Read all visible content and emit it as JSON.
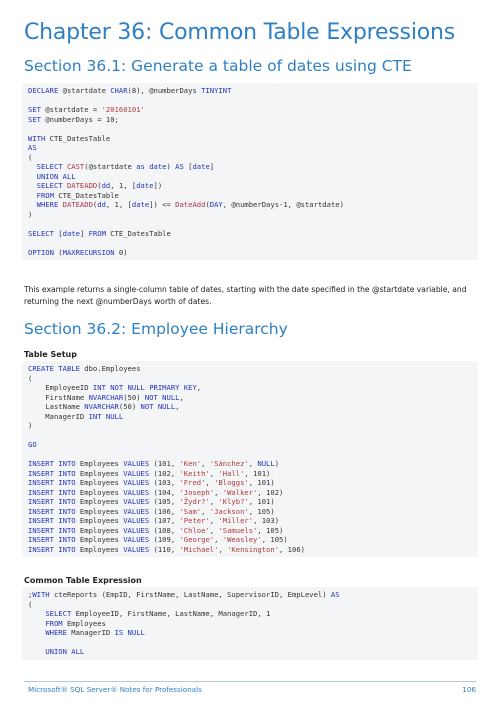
{
  "chapter_title": "Chapter 36: Common Table Expressions",
  "section1": {
    "title": "Section 36.1: Generate a table of dates using CTE",
    "code_lines": [
      "DECLARE @startdate CHAR(8), @numberDays TINYINT",
      "",
      "SET @startdate = '20160101'",
      "SET @numberDays = 10;",
      "",
      "WITH CTE_DatesTable",
      "AS",
      "(",
      "  SELECT CAST(@startdate as date) AS [date]",
      "  UNION ALL",
      "  SELECT DATEADD(dd, 1, [date])",
      "  FROM CTE_DatesTable",
      "  WHERE DATEADD(dd, 1, [date]) <= DateAdd(DAY, @numberDays-1, @startdate)",
      ")",
      "",
      "SELECT [date] FROM CTE_DatesTable",
      "",
      "OPTION (MAXRECURSION 0)"
    ],
    "paragraph": "This example returns a single-column table of dates, starting with the date specified in the @startdate variable, and returning the next @numberDays worth of dates."
  },
  "section2": {
    "title": "Section 36.2: Employee Hierarchy",
    "table_setup_label": "Table Setup",
    "table_setup_lines": [
      "CREATE TABLE dbo.Employees",
      "(",
      "    EmployeeID INT NOT NULL PRIMARY KEY,",
      "    FirstName NVARCHAR(50) NOT NULL,",
      "    LastName NVARCHAR(50) NOT NULL,",
      "    ManagerID INT NULL",
      ")",
      "",
      "GO",
      "",
      "INSERT INTO Employees VALUES (101, 'Ken', 'Sánchez', NULL)",
      "INSERT INTO Employees VALUES (102, 'Keith', 'Hall', 101)",
      "INSERT INTO Employees VALUES (103, 'Fred', 'Bloggs', 101)",
      "INSERT INTO Employees VALUES (104, 'Joseph', 'Walker', 102)",
      "INSERT INTO Employees VALUES (105, 'Žydr?', 'Klyb?', 101)",
      "INSERT INTO Employees VALUES (106, 'Sam', 'Jackson', 105)",
      "INSERT INTO Employees VALUES (107, 'Peter', 'Miller', 103)",
      "INSERT INTO Employees VALUES (108, 'Chloe', 'Samuels', 105)",
      "INSERT INTO Employees VALUES (109, 'George', 'Weasley', 105)",
      "INSERT INTO Employees VALUES (110, 'Michael', 'Kensington', 106)"
    ],
    "cte_label": "Common Table Expression",
    "cte_lines": [
      ";WITH cteReports (EmpID, FirstName, LastName, SupervisorID, EmpLevel) AS",
      "(",
      "    SELECT EmployeeID, FirstName, LastName, ManagerID, 1",
      "    FROM Employees",
      "    WHERE ManagerID IS NULL",
      "",
      "    UNION ALL"
    ]
  },
  "footer": {
    "left": "Microsoft® SQL Server® Notes for Professionals",
    "page_number": "106"
  }
}
